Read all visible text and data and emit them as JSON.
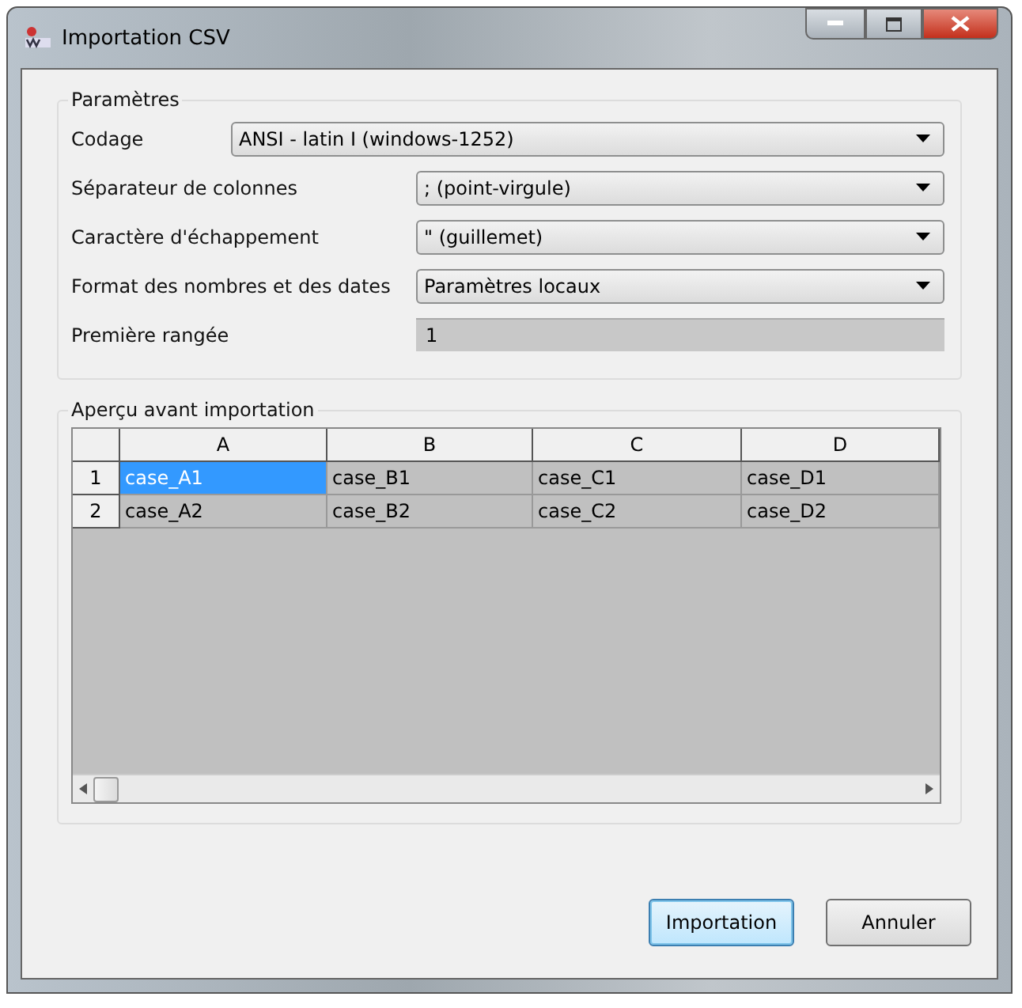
{
  "window": {
    "title": "Importation CSV"
  },
  "parameters": {
    "title": "Paramètres",
    "fields": [
      {
        "kind": "combo",
        "label": "Codage",
        "value": "ANSI - latin I (windows-1252)",
        "wide": true
      },
      {
        "kind": "combo",
        "label": "Séparateur de colonnes",
        "value": "; (point-virgule)",
        "wide": false
      },
      {
        "kind": "combo",
        "label": "Caractère d'échappement",
        "value": "\" (guillemet)",
        "wide": false
      },
      {
        "kind": "combo",
        "label": "Format des nombres et des dates",
        "value": "Paramètres locaux",
        "wide": false
      },
      {
        "kind": "readonly",
        "label": "Première rangée",
        "value": "1",
        "wide": false
      }
    ]
  },
  "preview": {
    "title": "Aperçu avant importation",
    "columns": [
      "A",
      "B",
      "C",
      "D"
    ],
    "rows": [
      {
        "header": "1",
        "cells": [
          {
            "text": "case_A1",
            "selected": true
          },
          {
            "text": "case_B1",
            "selected": false
          },
          {
            "text": "case_C1",
            "selected": false
          },
          {
            "text": "case_D1",
            "selected": false
          }
        ]
      },
      {
        "header": "2",
        "cells": [
          {
            "text": "case_A2",
            "selected": false
          },
          {
            "text": "case_B2",
            "selected": false
          },
          {
            "text": "case_C2",
            "selected": false
          },
          {
            "text": "case_D2",
            "selected": false
          }
        ]
      }
    ]
  },
  "buttons": [
    {
      "label": "Importation",
      "default": true
    },
    {
      "label": "Annuler",
      "default": false
    }
  ]
}
